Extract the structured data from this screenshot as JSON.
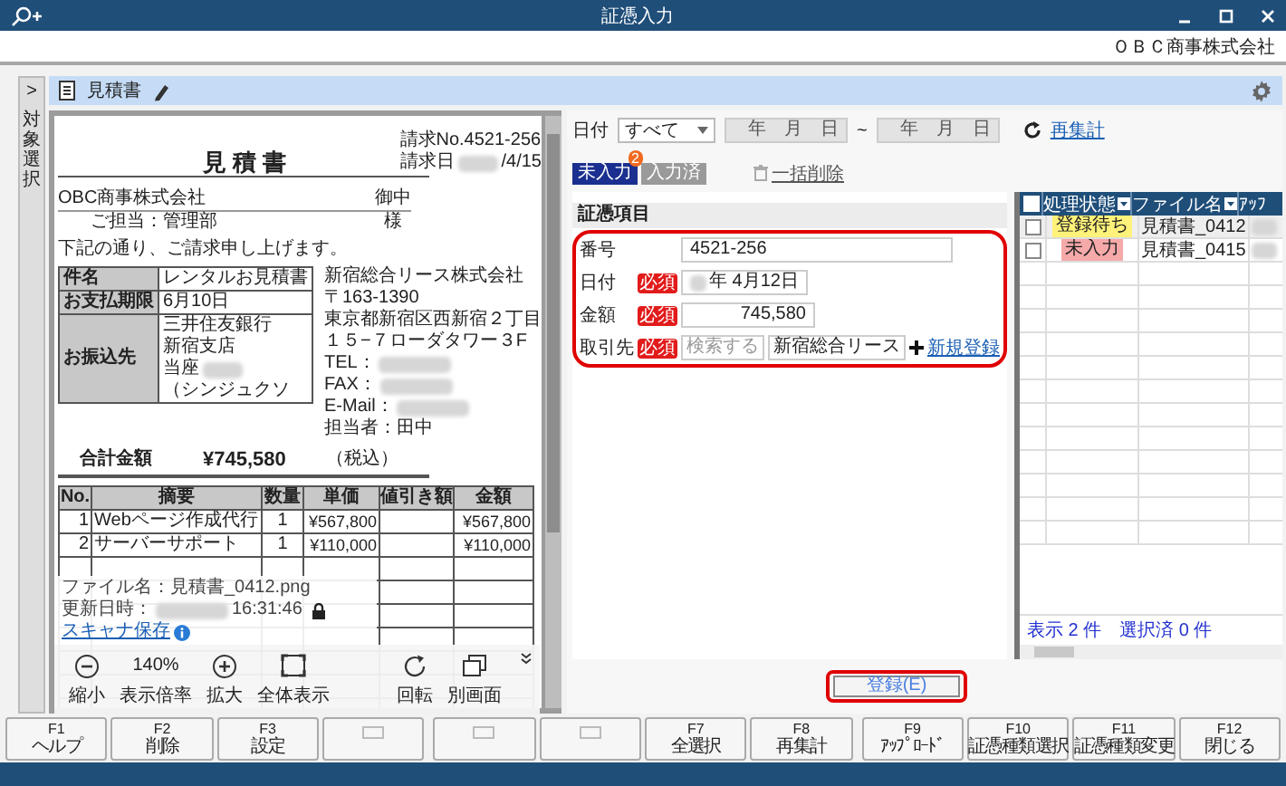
{
  "window": {
    "title": "証憑入力",
    "company": "ＯＢＣ商事株式会社"
  },
  "side_tab": {
    "arrow": ">",
    "label": "対象選択"
  },
  "header": {
    "title": "見積書"
  },
  "document": {
    "title": "見 積 書",
    "request_no": "請求No.4521-256",
    "request_date_label": "請求日",
    "request_date": "/4/15",
    "addressee": "OBC商事株式会社",
    "honorific": "御中",
    "contact": "ご担当：管理部",
    "contact_honorific": "様",
    "greeting": "下記の通り、ご請求申し上げます。",
    "info": [
      {
        "label": "件名",
        "lines": [
          {
            "text": "レンタルお見積書"
          }
        ]
      },
      {
        "label": "お支払期限",
        "lines": [
          {
            "text": "6月10日"
          }
        ]
      },
      {
        "label": "お振込先",
        "lines": [
          {
            "text": "三井住友銀行"
          },
          {
            "text": "新宿支店"
          },
          {
            "text": "当座",
            "blurred": true
          },
          {
            "text": "（シンジュクソ"
          }
        ]
      }
    ],
    "sender": [
      {
        "text": "新宿総合リース株式会社"
      },
      {
        "text": "〒163-1390"
      },
      {
        "text": "東京都新宿区西新宿２丁目"
      },
      {
        "text": "１５−７ローダタワー３F"
      },
      {
        "text": "TEL：",
        "blurred": true
      },
      {
        "text": "FAX：",
        "blurred": true
      },
      {
        "text": "E-Mail：",
        "blurred": true
      },
      {
        "text": "担当者：田中"
      }
    ],
    "total": {
      "label": "合計金額",
      "amount": "¥745,580",
      "note": "（税込）"
    },
    "items": {
      "columns": [
        "No.",
        "摘要",
        "数量",
        "単価",
        "値引き額",
        "金額"
      ],
      "rows": [
        [
          "1",
          "Webページ作成代行",
          "1",
          "¥567,800",
          null,
          "¥567,800"
        ],
        [
          "2",
          "サーバーサポート",
          "1",
          "¥110,000",
          null,
          "¥110,000"
        ]
      ]
    }
  },
  "file_info": {
    "name": "ファイル名：見積書_0412.png",
    "date_label": "更新日時：",
    "time": "16:31:46",
    "scanner_link": "スキャナ保存"
  },
  "viewer_tools": [
    {
      "kind": "zoom_out",
      "label": "縮小"
    },
    {
      "kind": "zoom_level",
      "value": "140%",
      "label": "表示倍率"
    },
    {
      "kind": "zoom_in",
      "label": "拡大"
    },
    {
      "kind": "fit",
      "label": "全体表示"
    },
    {
      "kind": "rotate",
      "label": "回転"
    },
    {
      "kind": "new_window",
      "label": "別画面"
    }
  ],
  "filter": {
    "label": "日付",
    "select": "すべて",
    "date_from": "年　月　日",
    "separator": "~",
    "date_to": "年　月　日",
    "refresh": "再集計"
  },
  "tabs": [
    {
      "label": "未入力",
      "selected": true,
      "badge": "2"
    },
    {
      "label": "入力済",
      "selected": false
    }
  ],
  "bulk_delete": "一括削除",
  "form": {
    "title": "証憑項目",
    "fields": [
      {
        "kind": "text",
        "label": "番号",
        "value": "4521-256"
      },
      {
        "kind": "date",
        "label": "日付",
        "badge": "必須",
        "value": "年  4月12日"
      },
      {
        "kind": "amount",
        "label": "金額",
        "badge": "必須",
        "value": "745,580"
      },
      {
        "kind": "partner",
        "label": "取引先",
        "badge": "必須",
        "placeholder": "検索する",
        "value": "新宿総合リース",
        "link": "新規登録"
      }
    ]
  },
  "list": {
    "all_checked": false,
    "columns": [
      {
        "label": "処理状態",
        "filter": true
      },
      {
        "label": "ファイル名",
        "filter": true
      },
      {
        "label": "ｱｯﾌ",
        "filter": false
      }
    ],
    "rows": [
      {
        "checked": false,
        "status": "登録待ち",
        "color": "#fff27a",
        "file": "見積書_0412"
      },
      {
        "checked": false,
        "status": "未入力",
        "color": "#f6a9a9",
        "file": "見積書_0415"
      }
    ],
    "shown": "表示 2 件",
    "selected_count": "選択済 0 件"
  },
  "register_button": "登録(E)",
  "function_keys": [
    {
      "kind": "key",
      "key": "F1",
      "label": "ヘルプ"
    },
    {
      "kind": "key",
      "key": "F2",
      "label": "削除"
    },
    {
      "kind": "key",
      "key": "F3",
      "label": "設定"
    },
    {
      "kind": "blank"
    },
    {
      "kind": "blank"
    },
    {
      "kind": "blank"
    },
    {
      "kind": "key",
      "key": "F7",
      "label": "全選択"
    },
    {
      "kind": "key",
      "key": "F8",
      "label": "再集計"
    },
    {
      "kind": "key",
      "key": "F9",
      "label": "ｱｯﾌﾟﾛｰﾄﾞ"
    },
    {
      "kind": "key",
      "key": "F10",
      "label": "証憑種類選択"
    },
    {
      "kind": "key",
      "key": "F11",
      "label": "証憑種類変更"
    },
    {
      "kind": "key",
      "key": "F12",
      "label": "閉じる"
    }
  ]
}
